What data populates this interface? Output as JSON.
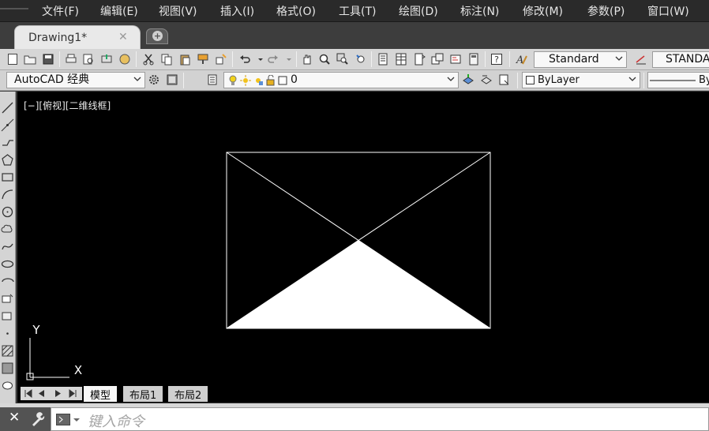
{
  "menu": [
    "文件(F)",
    "编辑(E)",
    "视图(V)",
    "插入(I)",
    "格式(O)",
    "工具(T)",
    "绘图(D)",
    "标注(N)",
    "修改(M)",
    "参数(P)",
    "窗口(W)"
  ],
  "tabs": {
    "drawing": "Drawing1*",
    "close": "✕",
    "new": "+"
  },
  "toolbar": {
    "text_style": "Standard",
    "dim_style": "STANDA",
    "workspace": "AutoCAD 经典",
    "layer": "0",
    "color": "ByLayer",
    "linetype": "By"
  },
  "viewport_label": "[−][俯视][二维线框]",
  "ucs": {
    "x_label": "X",
    "y_label": "Y"
  },
  "layout_tabs": [
    "模型",
    "布局1",
    "布局2"
  ],
  "command": {
    "placeholder": "键入命令",
    "close": "✕"
  },
  "colors": {
    "canvas": "#000000",
    "lines": "#ffffff",
    "fill": "#ffffff"
  }
}
